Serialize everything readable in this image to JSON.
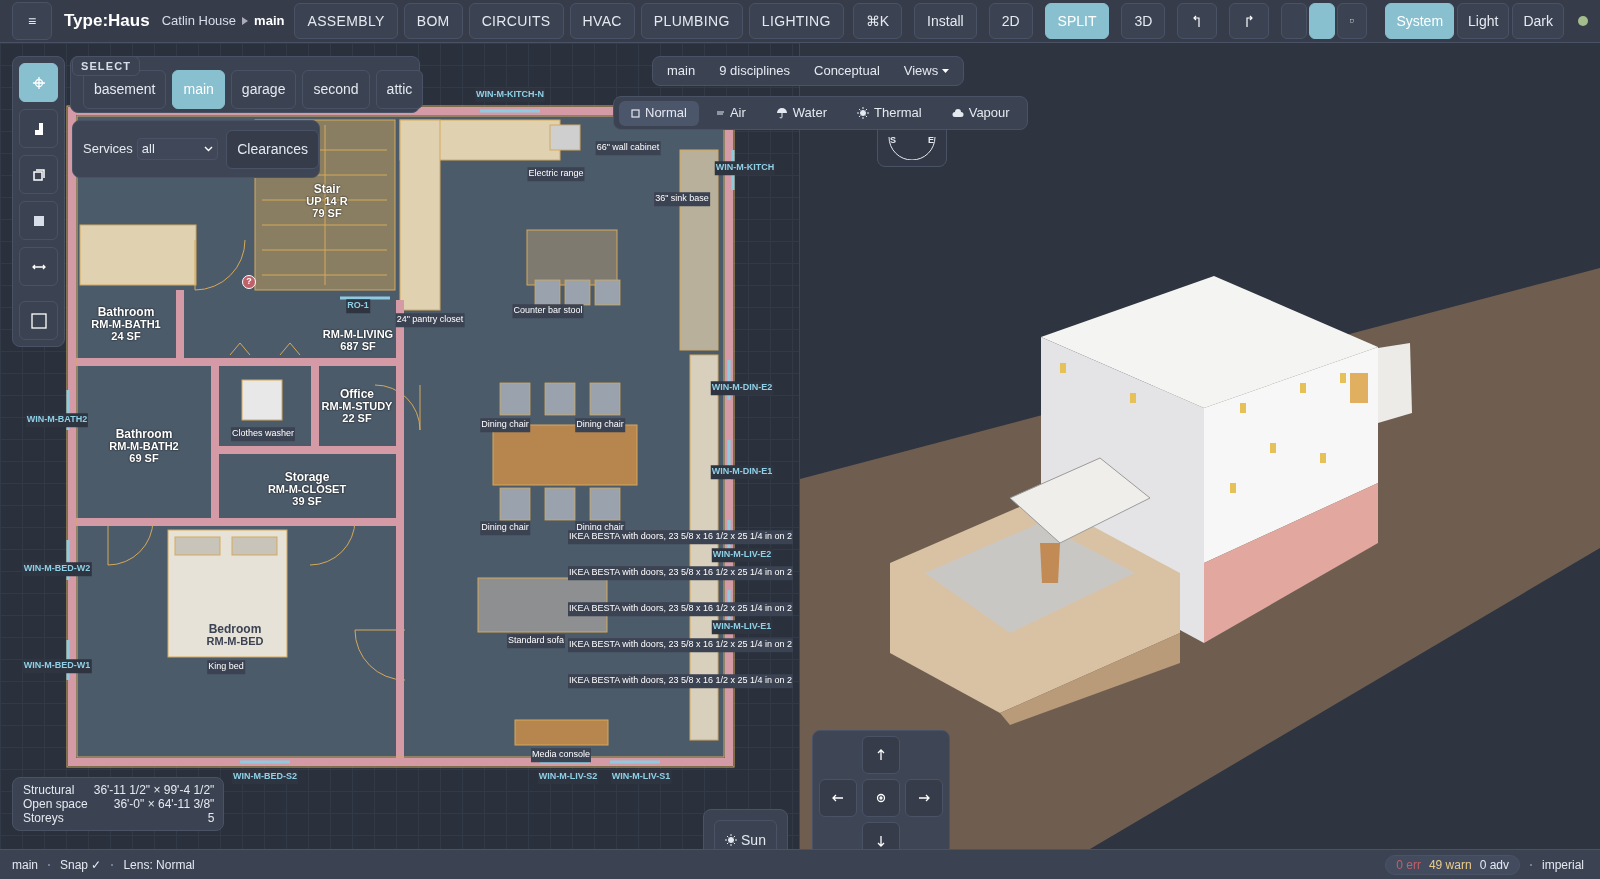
{
  "topbar": {
    "menu": "≡",
    "brand": "Type:Haus",
    "project": "Catlin House",
    "branch": "main",
    "modes": [
      "ASSEMBLY",
      "BOM",
      "CIRCUITS",
      "HVAC",
      "PLUMBING",
      "LIGHTING"
    ],
    "command": "⌘K",
    "install": "Install",
    "views": [
      {
        "label": "2D",
        "selected": false
      },
      {
        "label": "SPLIT",
        "selected": true
      },
      {
        "label": "3D",
        "selected": false
      }
    ],
    "density": [
      {
        "selected": false
      },
      {
        "selected": true
      },
      {
        "selected": false
      }
    ],
    "themes": [
      {
        "label": "System",
        "selected": true
      },
      {
        "label": "Light",
        "selected": false
      },
      {
        "label": "Dark",
        "selected": false
      }
    ],
    "status_dot": {
      "color": "#a3be8c"
    }
  },
  "tools": [
    {
      "selected": true
    },
    {
      "selected": false
    },
    {
      "selected": false
    },
    {
      "selected": false
    },
    {
      "selected": false
    },
    {
      "selected": false
    }
  ],
  "select_label": "SELECT",
  "floors": [
    {
      "label": "basement",
      "selected": false
    },
    {
      "label": "main",
      "selected": true
    },
    {
      "label": "garage",
      "selected": false
    },
    {
      "label": "second",
      "selected": false
    },
    {
      "label": "attic",
      "selected": false
    }
  ],
  "services": {
    "label": "Services",
    "value": "all",
    "button": "Clearances"
  },
  "plan_header": {
    "items": [
      "main",
      "9 disciplines",
      "Conceptual"
    ],
    "views": "Views"
  },
  "lenses": [
    {
      "label": "Normal",
      "selected": true
    },
    {
      "label": "Air",
      "selected": false
    },
    {
      "label": "Water",
      "selected": false
    },
    {
      "label": "Thermal",
      "selected": false
    },
    {
      "label": "Vapour",
      "selected": false
    }
  ],
  "compass": [
    "S",
    "E"
  ],
  "plan": {
    "rooms": [
      {
        "name": "Stair",
        "code": "UP 14 R",
        "area": "79 SF"
      },
      {
        "name": "Bathroom",
        "code": "RM-M-BATH1",
        "area": "24 SF"
      },
      {
        "code": "RM-M-LIVING",
        "area": "687 SF"
      },
      {
        "name": "Office",
        "code": "RM-M-STUDY",
        "area": "22 SF"
      },
      {
        "name": "Bathroom",
        "code": "RM-M-BATH2",
        "area": "69 SF"
      },
      {
        "name": "Storage",
        "code": "RM-M-CLOSET",
        "area": "39 SF"
      },
      {
        "name": "Bedroom",
        "code": "RM-M-BED"
      }
    ],
    "tags": [
      "WIN-M-KITCH-N",
      "WIN-M-KITCH",
      "WIN-M-BATH2",
      "WIN-M-BED-W2",
      "WIN-M-BED-W1",
      "WIN-M-BED-S2",
      "WIN-M-LIV-S2",
      "WIN-M-LIV-S1",
      "WIN-M-DIN-E2",
      "WIN-M-DIN-E1",
      "WIN-M-LIV-E2",
      "WIN-M-LIV-E1",
      "RO-1"
    ],
    "notes": [
      "Electric range",
      "66\" wall cabinet",
      "36\" sink base",
      "24\" pantry closet",
      "Counter bar stool",
      "Dining chair",
      "Dining chair",
      "Dining chair",
      "Dining chair",
      "Clothes washer",
      "King bed",
      "Standard sofa",
      "Media console",
      "IKEA BESTA with doors, 23 5/8 x 16 1/2 x 25 1/4 in on 2",
      "IKEA BESTA with doors, 23 5/8 x 16 1/2 x 25 1/4 in on 2",
      "IKEA BESTA with doors, 23 5/8 x 16 1/2 x 25 1/4 in on 2",
      "IKEA BESTA with doors, 23 5/8 x 16 1/2 x 25 1/4 in on 2",
      "IKEA BESTA with doors, 23 5/8 x 16 1/2 x 25 1/4 in on 2"
    ],
    "warning": "?"
  },
  "stats": [
    {
      "label": "Structural",
      "value": "36'-11 1/2\" × 99'-4 1/2\""
    },
    {
      "label": "Open space",
      "value": "36'-0\" × 64'-11 3/8\""
    },
    {
      "label": "Storeys",
      "value": "5"
    }
  ],
  "sun": "Sun",
  "status_bar": {
    "left": [
      "main",
      "Snap ✓",
      "Lens: Normal"
    ],
    "err": "0 err",
    "warn": "49 warn",
    "adv": "0 adv",
    "units": "imperial"
  }
}
